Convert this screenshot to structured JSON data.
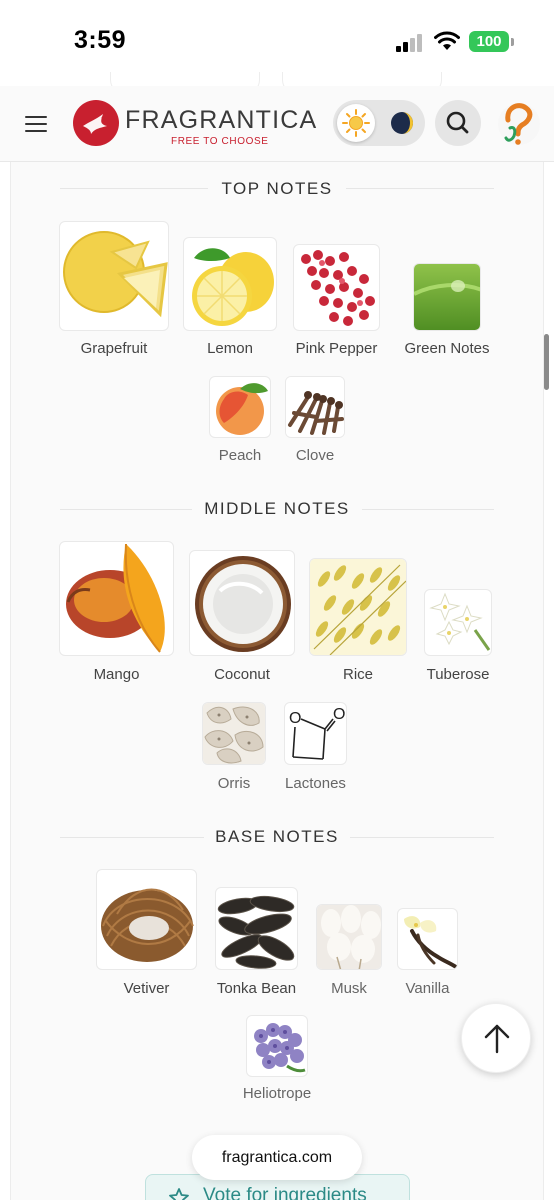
{
  "status_bar": {
    "time": "3:59",
    "battery": "100"
  },
  "header": {
    "brand": "FRAGRANTICA",
    "tagline": "FREE TO CHOOSE",
    "icons": [
      "menu-icon",
      "sun-icon",
      "moon-icon",
      "search-icon",
      "question-icon"
    ]
  },
  "sections": {
    "top": {
      "title": "TOP NOTES",
      "notes": [
        "Grapefruit",
        "Lemon",
        "Pink Pepper",
        "Green Notes",
        "Peach",
        "Clove"
      ]
    },
    "middle": {
      "title": "MIDDLE NOTES",
      "notes": [
        "Mango",
        "Coconut",
        "Rice",
        "Tuberose",
        "Orris",
        "Lactones"
      ]
    },
    "base": {
      "title": "BASE NOTES",
      "notes": [
        "Vetiver",
        "Tonka Bean",
        "Musk",
        "Vanilla",
        "Heliotrope"
      ]
    }
  },
  "footer": {
    "url": "fragrantica.com",
    "vote_label": "Vote for ingredients"
  },
  "colors": {
    "brand_red": "#c8202f",
    "battery_green": "#34c759",
    "vote_teal": "#2b8a86"
  }
}
